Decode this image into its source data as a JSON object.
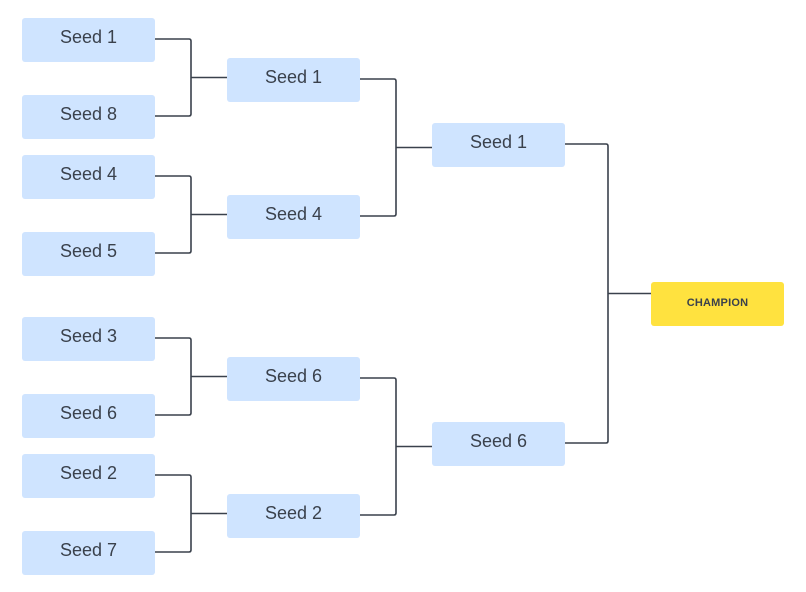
{
  "diagram": {
    "type": "tournament-bracket",
    "rounds": [
      {
        "name": "round-1",
        "slots": [
          "Seed 1",
          "Seed 8",
          "Seed 4",
          "Seed 5",
          "Seed 3",
          "Seed 6",
          "Seed 2",
          "Seed 7"
        ]
      },
      {
        "name": "round-2",
        "slots": [
          "Seed 1",
          "Seed 4",
          "Seed 6",
          "Seed 2"
        ]
      },
      {
        "name": "round-3",
        "slots": [
          "Seed 1",
          "Seed 6"
        ]
      }
    ],
    "champion": {
      "label": "CHAMPION"
    },
    "colors": {
      "slot_fill": "#cfe4ff",
      "champion_fill": "#ffe23f",
      "text": "#3a414c",
      "connector": "#3a414c"
    }
  }
}
